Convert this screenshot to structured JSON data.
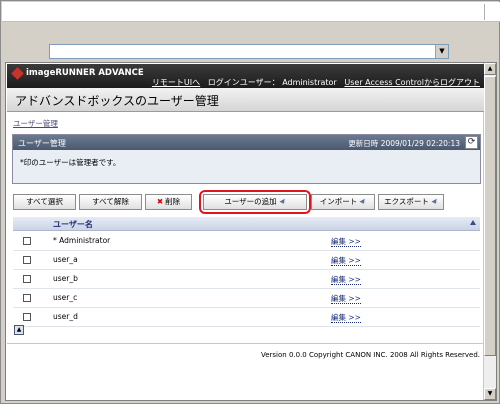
{
  "address_bar": {
    "value": ""
  },
  "header": {
    "logo": "imageRUNNER ADVANCE",
    "remote_ui_link": "リモートUIへ",
    "login_user_label": "ログインユーザー：",
    "login_user": "Administrator",
    "logout_link": "User Access Controlからログアウト"
  },
  "page_title": "アドバンスドボックスのユーザー管理",
  "breadcrumb": "ユーザー管理",
  "panel": {
    "title": "ユーザー管理",
    "updated": "更新日時 2009/01/29 02:20:13",
    "message": "*印のユーザーは管理者です。"
  },
  "toolbar": {
    "select_all": "すべて選択",
    "deselect_all": "すべて解除",
    "delete": "削除",
    "add_user": "ユーザーの追加",
    "import": "インポート",
    "export": "エクスポート"
  },
  "table": {
    "header": "ユーザー名",
    "rows": [
      {
        "name": "* Administrator",
        "edit": "編集 >>"
      },
      {
        "name": "user_a",
        "edit": "編集 >>"
      },
      {
        "name": "user_b",
        "edit": "編集 >>"
      },
      {
        "name": "user_c",
        "edit": "編集 >>"
      },
      {
        "name": "user_d",
        "edit": "編集 >>"
      }
    ]
  },
  "footer": "Version 0.0.0 Copyright CANON INC. 2008 All Rights Reserved.",
  "colors": {
    "header_bg": "#1c1c1c",
    "accent": "#4a5870",
    "highlight": "#e0141e"
  }
}
